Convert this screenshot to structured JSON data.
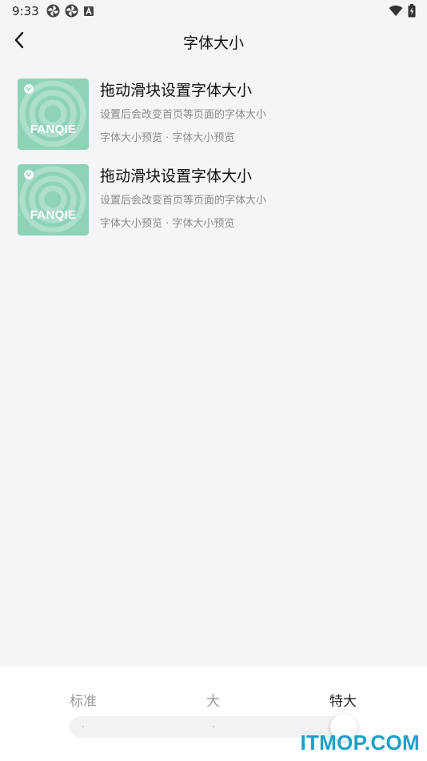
{
  "status_bar": {
    "time": "9:33",
    "left_icons": [
      "pinwheel-icon",
      "pinwheel-icon",
      "a-notification-icon"
    ],
    "right_icons": [
      "wifi-icon",
      "battery-charging-icon"
    ]
  },
  "header": {
    "title": "字体大小",
    "back_icon": "chevron-left-icon"
  },
  "items": [
    {
      "thumb_text": "FANQIE",
      "title": "拖动滑块设置字体大小",
      "description": "设置后会改变首页等页面的字体大小",
      "meta": "字体大小预览 · 字体大小预览"
    },
    {
      "thumb_text": "FANQIE",
      "title": "拖动滑块设置字体大小",
      "description": "设置后会改变首页等页面的字体大小",
      "meta": "字体大小预览 · 字体大小预览"
    }
  ],
  "font_size_selector": {
    "options": [
      "标准",
      "大",
      "特大"
    ],
    "selected": "特大",
    "selected_index": 2
  },
  "watermark": "ITMOP.COM",
  "colors": {
    "background": "#f4f5f7",
    "thumbnail": "#8ed3b7",
    "watermark": "#1aa1c8"
  }
}
